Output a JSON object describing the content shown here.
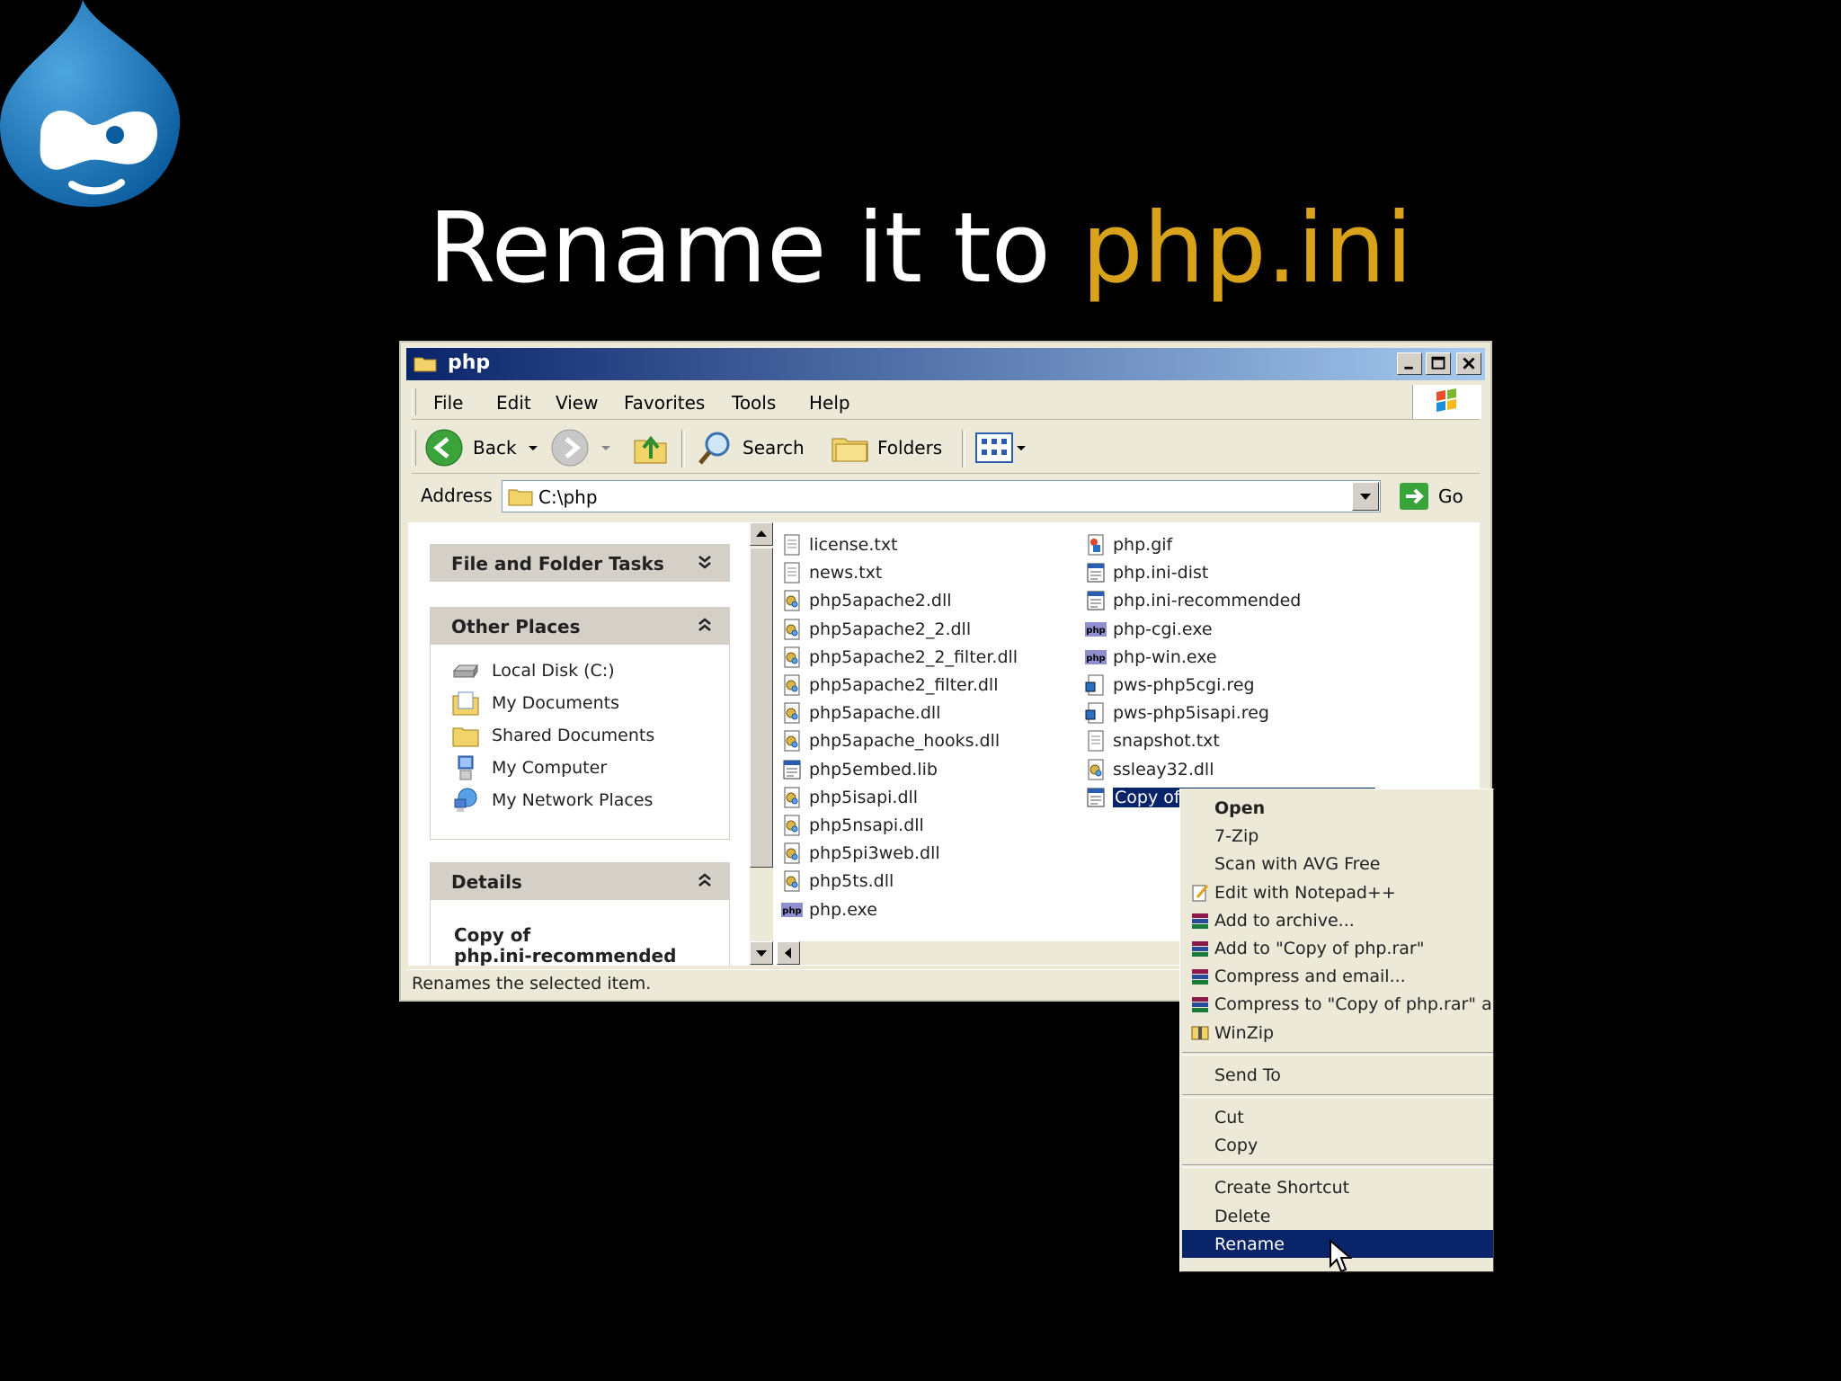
{
  "slide": {
    "title_main": "Rename it to ",
    "title_accent": "php.ini",
    "accent_color": "#d9a21b",
    "logo_icon": "drupal-drop-icon"
  },
  "window": {
    "title": "php",
    "menu": [
      "File",
      "Edit",
      "View",
      "Favorites",
      "Tools",
      "Help"
    ],
    "toolbar": {
      "back": "Back",
      "search": "Search",
      "folders": "Folders"
    },
    "address": {
      "label": "Address",
      "value": "C:\\php",
      "go": "Go"
    },
    "tasks_panel": {
      "title": "File and Folder Tasks"
    },
    "other_places": {
      "title": "Other Places",
      "items": [
        "Local Disk (C:)",
        "My Documents",
        "Shared Documents",
        "My Computer",
        "My Network Places"
      ]
    },
    "details": {
      "title": "Details",
      "line1": "Copy of",
      "line2": "php.ini-recommended"
    },
    "files_col1": [
      "license.txt",
      "news.txt",
      "php5apache2.dll",
      "php5apache2_2.dll",
      "php5apache2_2_filter.dll",
      "php5apache2_filter.dll",
      "php5apache.dll",
      "php5apache_hooks.dll",
      "php5embed.lib",
      "php5isapi.dll",
      "php5nsapi.dll",
      "php5pi3web.dll",
      "php5ts.dll",
      "php.exe"
    ],
    "files_col2": [
      "php.gif",
      "php.ini-dist",
      "php.ini-recommended",
      "php-cgi.exe",
      "php-win.exe",
      "pws-php5cgi.reg",
      "pws-php5isapi.reg",
      "snapshot.txt",
      "ssleay32.dll",
      "Copy of php.ini-recommended"
    ],
    "status": "Renames the selected item."
  },
  "context_menu": {
    "items": [
      "Open",
      "7-Zip",
      "Scan with AVG Free",
      "Edit with Notepad++",
      "Add to archive...",
      "Add to \"Copy of php.rar\"",
      "Compress and email...",
      "Compress to \"Copy of php.rar\" and email",
      "WinZip",
      "Send To",
      "Cut",
      "Copy",
      "Create Shortcut",
      "Delete",
      "Rename"
    ],
    "highlight_color": "#0a246a"
  }
}
